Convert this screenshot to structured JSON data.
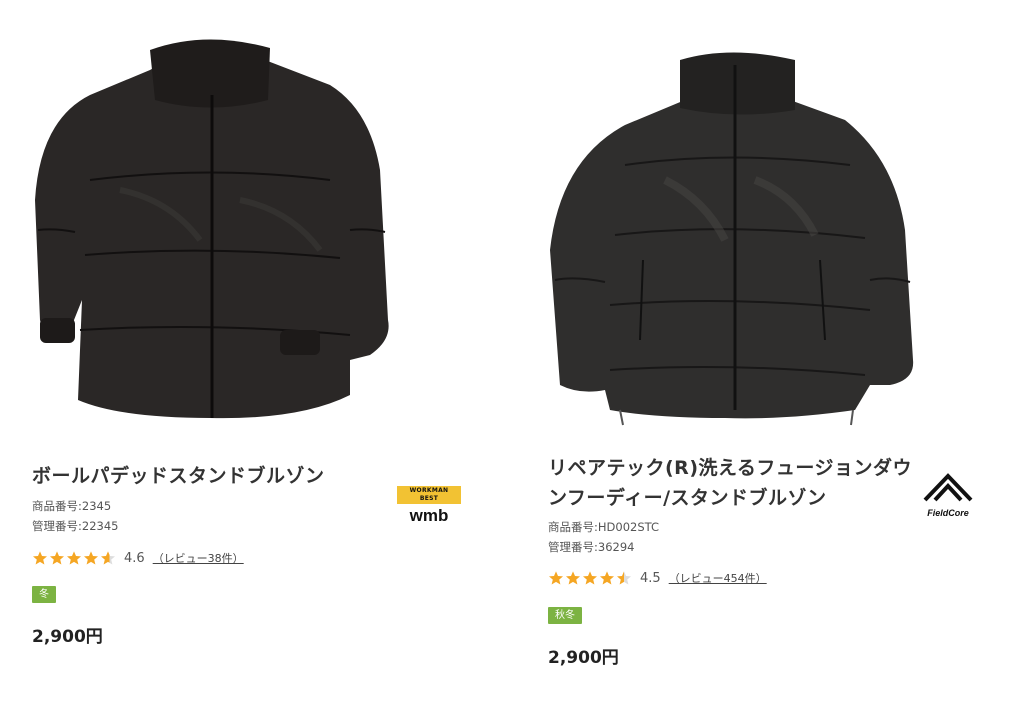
{
  "products": [
    {
      "title": "ボールパデッドスタンドブルゾン",
      "product_number": "商品番号:2345",
      "management_number": "管理番号:22345",
      "rating": "4.6",
      "reviews_label": "（レビュー38件）",
      "rating_value": 4.6,
      "season": "冬",
      "price": "2,900円",
      "brand_top": "WORKMAN BEST",
      "brand_main": "wmb",
      "jacket_color": "#2a2726"
    },
    {
      "title_line1": "リペアテック(R)洗えるフュージョンダウ",
      "title_line2": "ンフーディー/スタンドブルゾン",
      "product_number": "商品番号:HD002STC",
      "management_number": "管理番号:36294",
      "rating": "4.5",
      "reviews_label": "（レビュー454件）",
      "rating_value": 4.5,
      "season": "秋冬",
      "price": "2,900円",
      "brand_main": "FieldCore",
      "jacket_color": "#2f2e2d"
    }
  ],
  "colors": {
    "star": "#f5a623",
    "badge": "#7cb342",
    "wmb_yellow": "#f2c233"
  },
  "icons": [
    "star-icon",
    "half-star-icon",
    "wmb-logo",
    "fieldcore-logo"
  ]
}
